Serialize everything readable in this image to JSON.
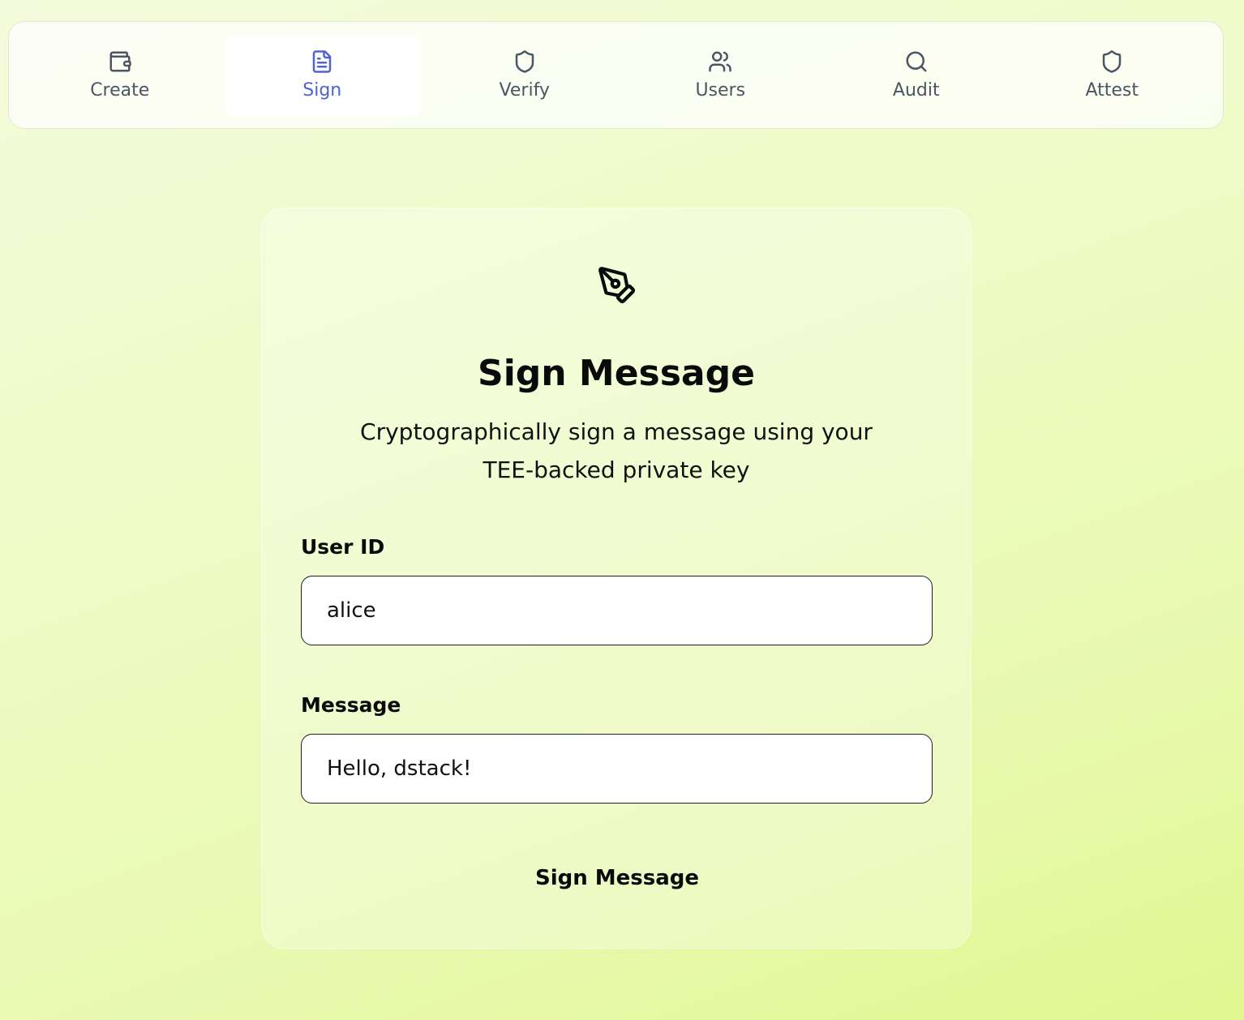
{
  "nav": {
    "tabs": [
      {
        "label": "Create",
        "icon": "wallet-icon"
      },
      {
        "label": "Sign",
        "icon": "document-icon",
        "active": true
      },
      {
        "label": "Verify",
        "icon": "shield-icon"
      },
      {
        "label": "Users",
        "icon": "users-icon"
      },
      {
        "label": "Audit",
        "icon": "search-icon"
      },
      {
        "label": "Attest",
        "icon": "shield-icon"
      }
    ],
    "active_color": "#4f63d2",
    "inactive_color": "#4b5563"
  },
  "card": {
    "icon": "pen-tool-icon",
    "title": "Sign Message",
    "subtitle": "Cryptographically sign a message using your TEE-backed private key"
  },
  "form": {
    "user_id_label": "User ID",
    "user_id_value": "alice",
    "message_label": "Message",
    "message_value": "Hello, dstack!",
    "submit_label": "Sign Message"
  }
}
